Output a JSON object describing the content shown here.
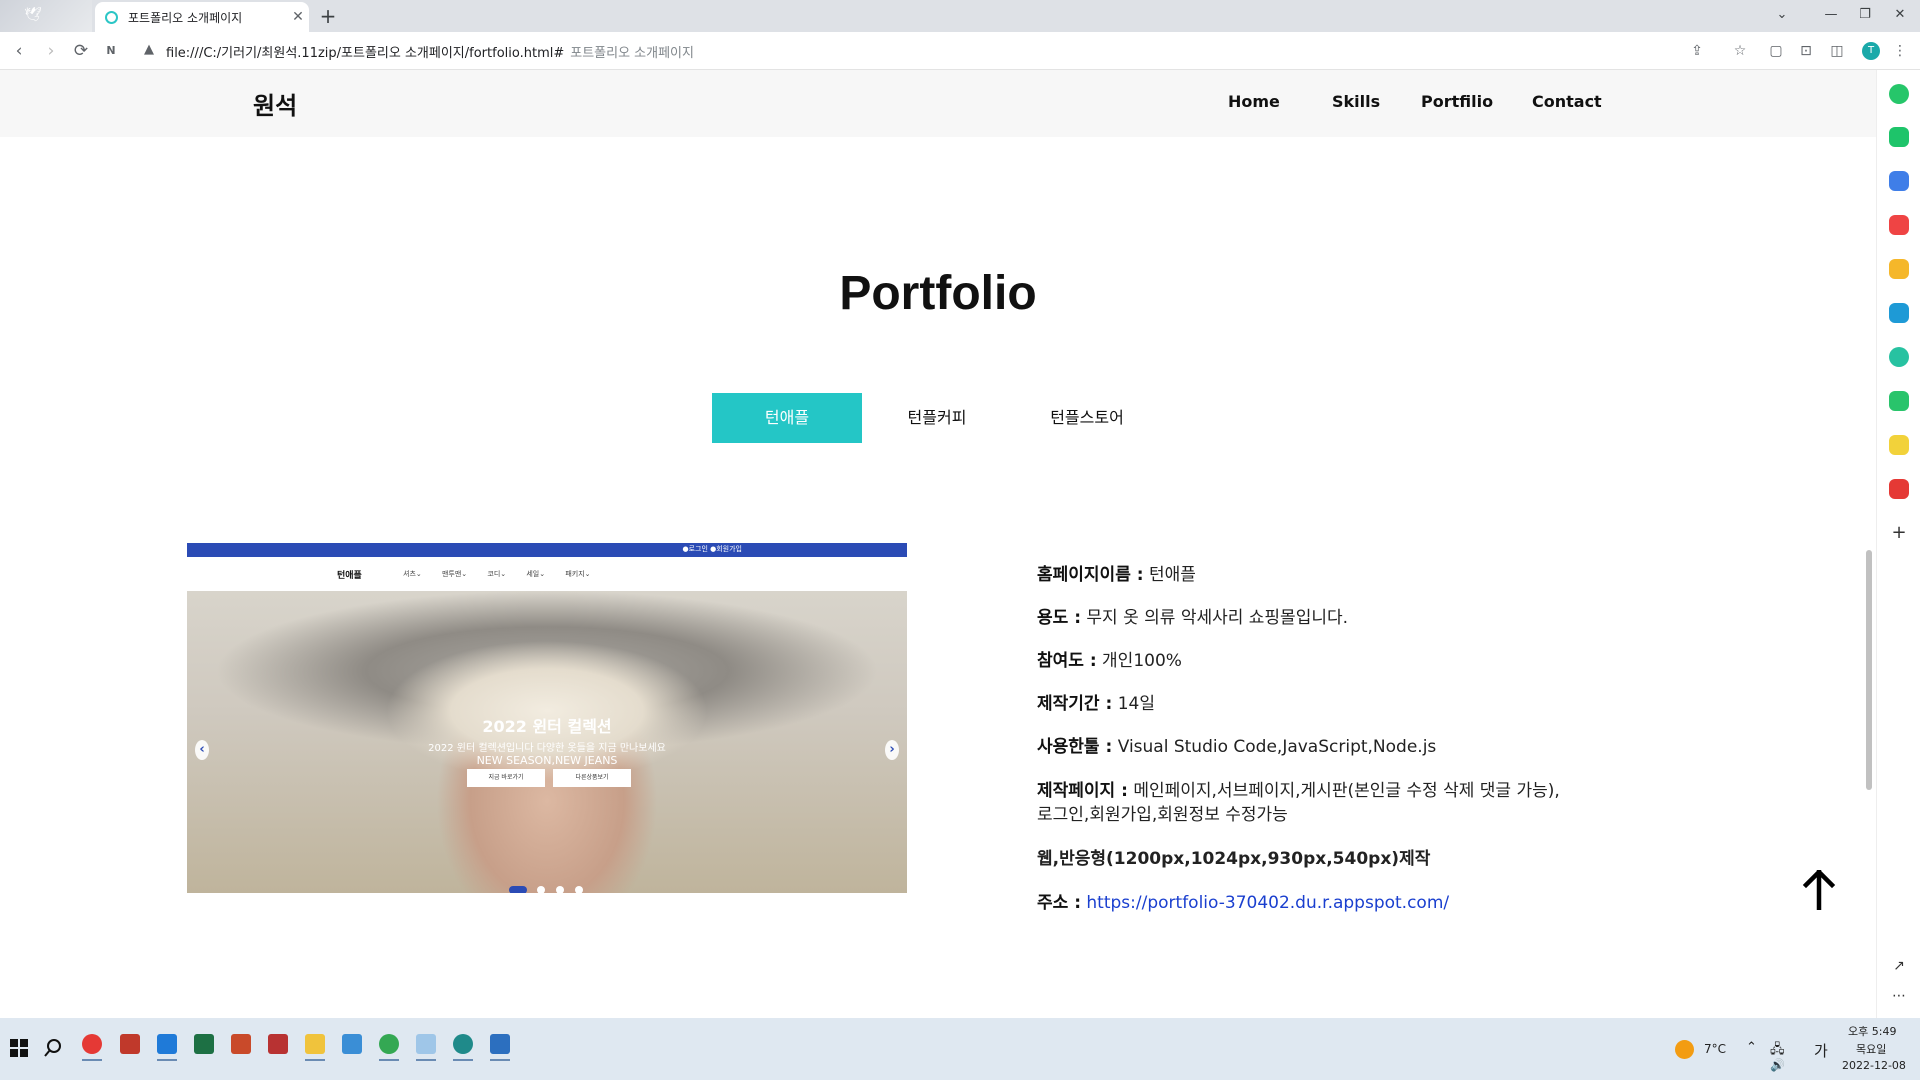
{
  "browser": {
    "tab_title": "포트폴리오 소개페이지",
    "tab_close": "✕",
    "new_tab": "+",
    "url": "file:///C:/기러기/최원석.11zip/포트폴리오 소개페이지/fortfolio.html#",
    "url_hint": "포트폴리오 소개페이지",
    "profile_initial": "T",
    "window_controls": [
      "⌄",
      "—",
      "❐",
      "✕"
    ]
  },
  "site": {
    "logo": "원석",
    "menu": [
      "Home",
      "Skills",
      "Portfilio",
      "Contact"
    ]
  },
  "section": {
    "title": "Portfolio",
    "tabs": [
      "턴애플",
      "턴플커피",
      "턴플스토어"
    ],
    "active_tab": 0
  },
  "slider": {
    "topbar_links": "●로그인   ●회원가입",
    "brand": "턴애플",
    "nav_items": "셔츠⌄ 맨투맨⌄ 코디⌄ 세일⌄ 패키지⌄",
    "headline": "2022 윈터 컬렉션",
    "subline": "2022 윈터 컬렉션입니다 다양한 옷들을 지금 만나보세요",
    "subline2": "NEW SEASON,NEW JEANS",
    "button1": "지금 바로가기",
    "button2": "다른상품보기",
    "prev": "‹",
    "next": "›",
    "slide_count": 4,
    "current_slide": 0
  },
  "info": {
    "name_label": "홈페이지이름 :",
    "name_value": "턴애플",
    "use_label": "용도 :",
    "use_value": "무지 옷 의류 악세사리 쇼핑몰입니다.",
    "contrib_label": "참여도 :",
    "contrib_value": "개인100%",
    "period_label": "제작기간 :",
    "period_value": "14일",
    "tools_label": "사용한툴 :",
    "tools_value": "Visual Studio Code,JavaScript,Node.js",
    "pages_label": "제작페이지 :",
    "pages_value": "메인페이지,서브페이지,게시판(본인글 수정 삭제 댓글 가능),",
    "pages_value2": "로그인,회원가입,회원정보 수정가능",
    "responsive": "웹,반응형(1200px,1024px,930px,540px)제작",
    "address_label": "주소 :",
    "address_value": "https://portfolio-370402.du.r.appspot.com/"
  },
  "taskbar": {
    "weather": "7°C",
    "ime": "가",
    "time": "오후 5:49",
    "day": "목요일",
    "date": "2022-12-08"
  },
  "colors": {
    "accent": "#24c6c6",
    "slider_blue": "#2b4bb5",
    "link": "#1a3fcf"
  }
}
